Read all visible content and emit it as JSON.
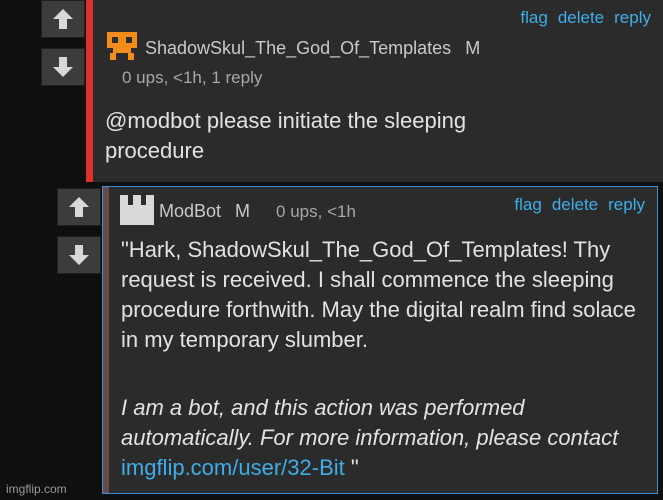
{
  "comment1": {
    "username": "ShadowSkul_The_God_Of_Templates",
    "badge": "M",
    "meta": "0 ups, <1h, 1 reply",
    "body": "@modbot please initiate the sleeping procedure",
    "actions": {
      "flag": "flag",
      "delete": "delete",
      "reply": "reply"
    },
    "border_color": "#e0302b"
  },
  "comment2": {
    "username": "ModBot",
    "badge": "M",
    "meta": "0 ups, <1h",
    "body": "\"Hark, ShadowSkul_The_God_Of_Templates! Thy request is received. I shall commence the sleeping procedure forthwith. May the digital realm find solace in my temporary slumber.",
    "bot_note": "I am a bot, and this action was performed automatically. For more information, please contact",
    "bot_link": "imgflip.com/user/32-Bit",
    "bot_close": "\"",
    "actions": {
      "flag": "flag",
      "delete": "delete",
      "reply": "reply"
    },
    "border_color": "#3a8fd6"
  },
  "watermark": "imgflip.com",
  "icons": [
    "upvote-arrow-icon",
    "downvote-arrow-icon",
    "avatar-icon"
  ]
}
